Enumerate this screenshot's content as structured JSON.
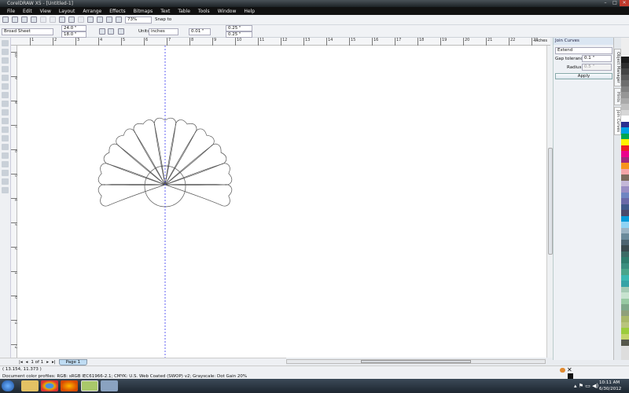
{
  "window": {
    "title": "CorelDRAW X5 - [Untitled-1]",
    "buttons": [
      "–",
      "□",
      "✕"
    ]
  },
  "menu": [
    "File",
    "Edit",
    "View",
    "Layout",
    "Arrange",
    "Effects",
    "Bitmaps",
    "Text",
    "Table",
    "Tools",
    "Window",
    "Help"
  ],
  "toolbar": {
    "zoom": "73%",
    "snap_to": "Snap to"
  },
  "property_bar": {
    "page_size": "Broad Sheet",
    "width": "24.0 \"",
    "height": "18.0 \"",
    "units_label": "Units:",
    "units": "inches",
    "nudge": "0.01 \"",
    "dup_x": "0.25 \"",
    "dup_y": "0.25 \""
  },
  "ruler": {
    "unit": "inches",
    "h_labels": [
      "1",
      "2",
      "3",
      "4",
      "5",
      "6",
      "7",
      "8",
      "9",
      "10",
      "11",
      "12",
      "13",
      "14",
      "15",
      "16",
      "17",
      "18",
      "19",
      "20",
      "21",
      "22",
      "23"
    ],
    "v_labels": [
      "10",
      "9",
      "8",
      "7",
      "6",
      "5",
      "4",
      "3",
      "2",
      "1",
      "0",
      "-1",
      "-2"
    ]
  },
  "docker": {
    "title": "Join Curves",
    "mode": "Extend",
    "gap_label": "Gap tolerance:",
    "gap_value": "0.1 \"",
    "radius_label": "Radius:",
    "radius_value": "0.5 \"",
    "apply": "Apply"
  },
  "side_tabs": [
    "Object Manager",
    "Hints",
    "Join Curves"
  ],
  "palette": [
    "#1a1a1a",
    "#2e2e2e",
    "#444",
    "#5a5a5a",
    "#6e6e6e",
    "#828282",
    "#969696",
    "#aaa",
    "#c0c0c0",
    "#d6d6d6",
    "#fff",
    "#2b2f8f",
    "#00a0e3",
    "#00a651",
    "#fff200",
    "#ed1c24",
    "#ec008c",
    "#a0287d",
    "#f7941d",
    "#f4a5a8",
    "#7d6b5d",
    "#c4b8d8",
    "#9a8ec4",
    "#6f86c2",
    "#6a6aa8",
    "#3f5a8a",
    "#4b4a6b",
    "#0a9ad8",
    "#8fd3f4",
    "#9bb3c3",
    "#6b8a9b",
    "#4d6470",
    "#3a4a4e",
    "#3d6b66",
    "#2f7d6d",
    "#3b8f7f",
    "#4aa58a",
    "#3cb8b2",
    "#35a3a6",
    "#a6cbb5",
    "#c8e3d0",
    "#98c9a3",
    "#7fa88a",
    "#8fa07a",
    "#a9b86a",
    "#b9c47d",
    "#9ccc3c",
    "#c4d56a",
    "#55574a"
  ],
  "page_nav": {
    "count": "1 of 1",
    "page_tab": "Page 1"
  },
  "status": {
    "coords": "( 13.154, 11.373 )",
    "profiles": "Document color profiles: RGB: sRGB IEC61966-2.1; CMYK: U.S. Web Coated (SWOP) v2; Grayscale: Dot Gain 20%"
  },
  "tray": {
    "time": "10:11 AM",
    "date": "6/30/2012"
  },
  "colors": {
    "guide": "#3a3af0",
    "outline": "#555555"
  }
}
